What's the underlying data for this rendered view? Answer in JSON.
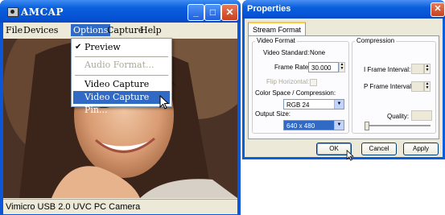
{
  "amcap": {
    "title": "AMCAP",
    "controls": {
      "minimize": "_",
      "maximize": "□",
      "close": "✕"
    },
    "menu": [
      "File",
      "Devices",
      "Options",
      "Capture",
      "Help"
    ],
    "options_menu": {
      "items": [
        {
          "label": "Preview",
          "checked": true,
          "disabled": false
        },
        {
          "label": "Audio Format...",
          "checked": false,
          "disabled": true
        },
        {
          "label": "Video Capture Filter...",
          "checked": false,
          "disabled": false
        },
        {
          "label": "Video Capture Pin...",
          "checked": false,
          "disabled": false,
          "highlighted": true
        }
      ],
      "check_glyph": "✔"
    },
    "status": "Vimicro USB 2.0 UVC PC Camera"
  },
  "properties": {
    "title": "Properties",
    "close": "✕",
    "tab": "Stream Format",
    "video_format": {
      "label": "Video Format",
      "video_standard_label": "Video Standard:",
      "video_standard_value": "None",
      "frame_rate_label": "Frame Rate:",
      "frame_rate_value": "30.000",
      "flip_horizontal_label": "Flip Horizontal:",
      "color_space_label": "Color Space / Compression:",
      "color_space_value": "RGB 24",
      "output_size_label": "Output Size:",
      "output_size_value": "640 x 480"
    },
    "compression": {
      "label": "Compression",
      "i_frame_label": "I Frame Interval:",
      "p_frame_label": "P Frame Interval:",
      "quality_label": "Quality:"
    },
    "buttons": {
      "ok": "OK",
      "cancel": "Cancel",
      "apply": "Apply"
    }
  },
  "colors": {
    "xp_blue": "#0a5fdc",
    "highlight": "#316ac5",
    "face": "#ece9d8"
  }
}
